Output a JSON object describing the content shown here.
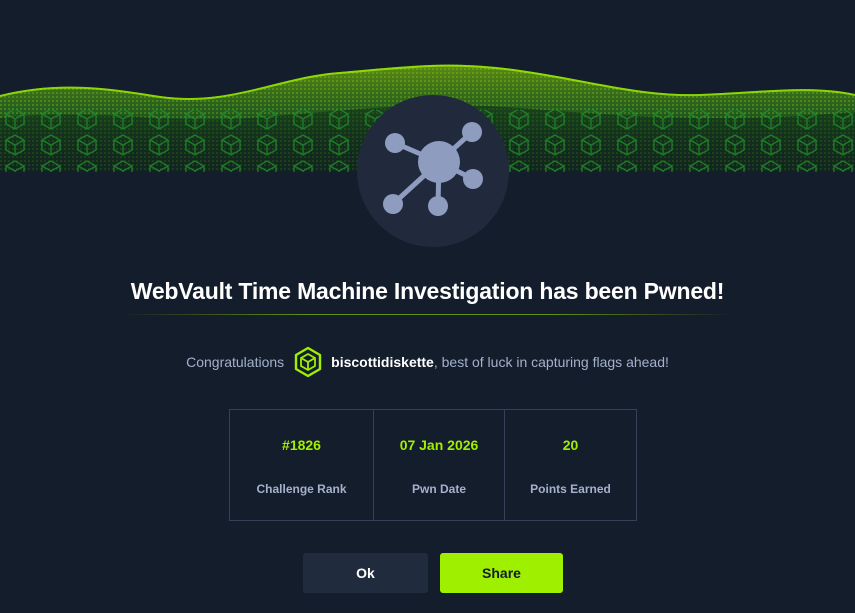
{
  "modal": {
    "title": "WebVault Time Machine Investigation has been Pwned!",
    "congrats_prefix": "Congratulations",
    "username": "biscottidiskette",
    "congrats_suffix": ", best of luck in capturing flags ahead!",
    "badge_icon": "network-hub-icon",
    "user_icon": "hexagon-cube-icon"
  },
  "stats": [
    {
      "value": "#1826",
      "label": "Challenge Rank"
    },
    {
      "value": "07 Jan 2026",
      "label": "Pwn Date"
    },
    {
      "value": "20",
      "label": "Points Earned"
    }
  ],
  "buttons": {
    "ok": "Ok",
    "share": "Share"
  },
  "colors": {
    "background": "#141d2b",
    "accent": "#9fef00",
    "panel": "#202a3c",
    "muted_text": "#a4b1cd"
  }
}
